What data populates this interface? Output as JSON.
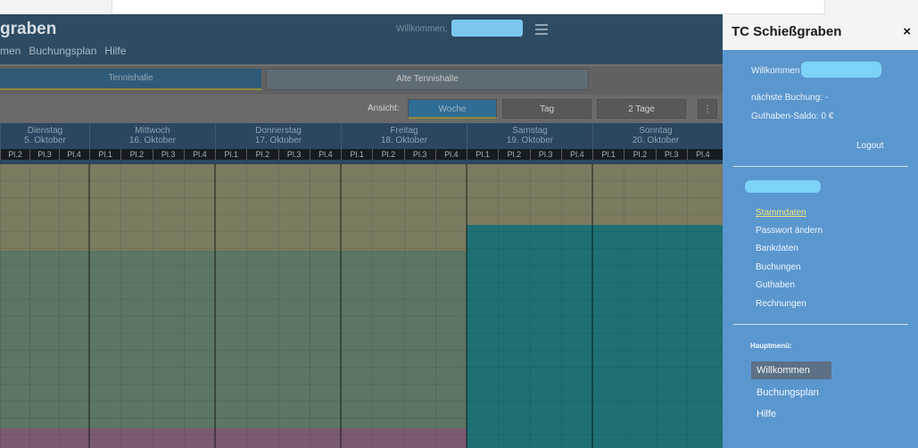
{
  "header": {
    "brand": "graben",
    "nav": [
      "men",
      "Buchungsplan",
      "Hilfe"
    ],
    "welcome": "Willkommen,"
  },
  "halls": [
    "Tennishalle",
    "Alte Tennishalle"
  ],
  "view": {
    "label": "Ansicht:",
    "options": [
      "Woche",
      "Tag",
      "2 Tage"
    ],
    "active": "Woche"
  },
  "days": [
    {
      "name": "Dienstag",
      "date": "5. Oktober"
    },
    {
      "name": "Mittwoch",
      "date": "16. Oktober"
    },
    {
      "name": "Donnerstag",
      "date": "17. Oktober"
    },
    {
      "name": "Freitag",
      "date": "18. Oktober"
    },
    {
      "name": "Samstag",
      "date": "19. Oktober"
    },
    {
      "name": "Sonntag",
      "date": "20. Oktober"
    }
  ],
  "first_day_courts": [
    "Pl.2",
    "Pl.3",
    "Pl.4"
  ],
  "courts": [
    "Pl.1",
    "Pl.2",
    "Pl.3",
    "Pl.4"
  ],
  "colors": {
    "yellow": "#7c7a5f",
    "green": "#5d7564",
    "teal": "#1f7073",
    "pink": "#7a5a73",
    "panel": "#5b97cf"
  },
  "panel": {
    "title": "TC Schießgraben",
    "close": "×",
    "welcome": "Willkommen",
    "next_booking": "nächste Buchung: -",
    "balance": "Guthaben-Saldo: 0 €",
    "logout": "Logout",
    "user_links": [
      "Stammdaten",
      "Passwort ändern",
      "Bankdaten",
      "Buchungen",
      "Guthaben",
      "Rechnungen"
    ],
    "main_menu_label": "Hauptmenü:",
    "main_links": [
      "Willkommen",
      "Buchungsplan",
      "Hilfe"
    ]
  }
}
